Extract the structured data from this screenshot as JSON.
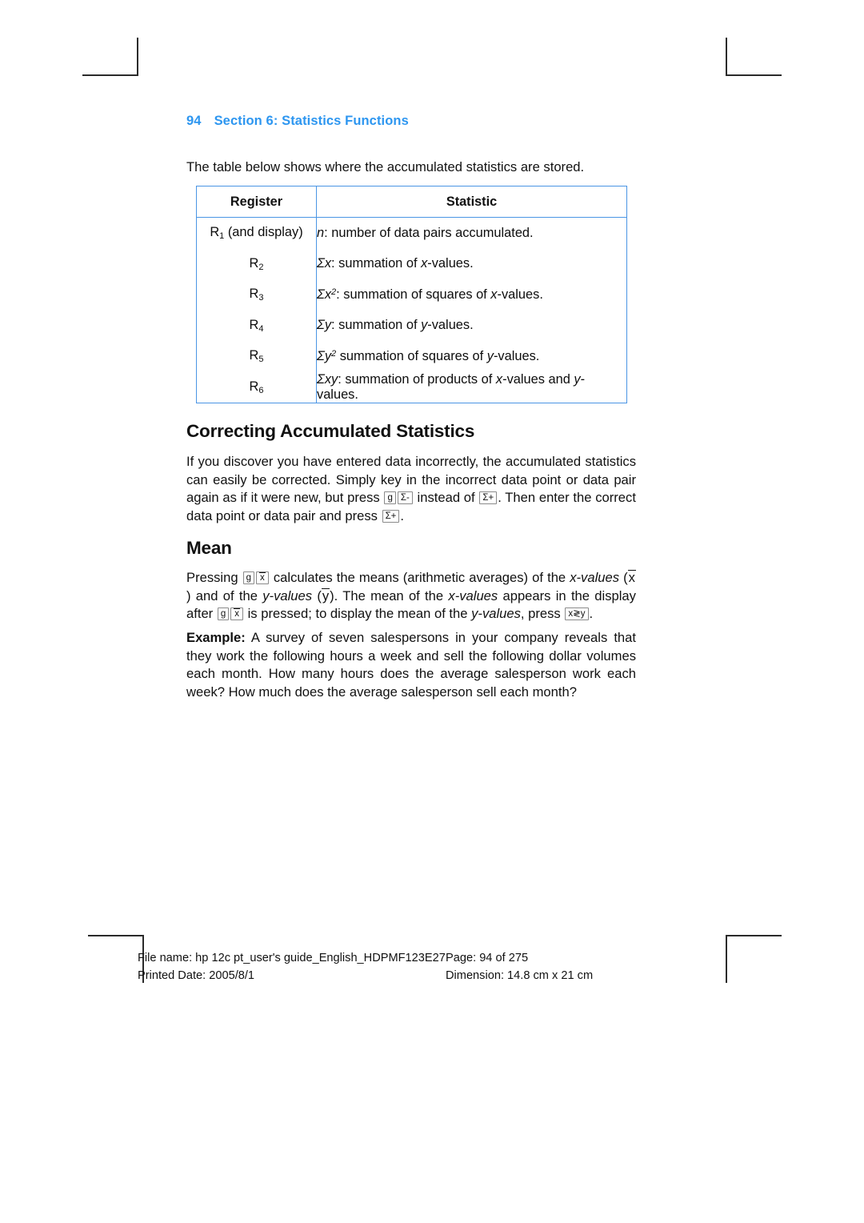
{
  "page": {
    "running_head": {
      "page_number": "94",
      "section_title": "Section 6: Statistics Functions"
    },
    "intro_line": "The table below shows where the accumulated statistics are stored."
  },
  "table": {
    "columns": [
      "Register",
      "Statistic"
    ],
    "rows": [
      {
        "register_base": "R",
        "register_sub": "1",
        "register_suffix": " (and display)",
        "statistic_prefix": "n",
        "statistic_sup": "",
        "statistic_text": ": number of data pairs accumulated."
      },
      {
        "register_base": "R",
        "register_sub": "2",
        "register_suffix": "",
        "statistic_prefix": "Σx",
        "statistic_sup": "",
        "statistic_text": ": summation of x-values."
      },
      {
        "register_base": "R",
        "register_sub": "3",
        "register_suffix": "",
        "statistic_prefix": "Σx",
        "statistic_sup": "2",
        "statistic_text": ": summation of squares of x-values."
      },
      {
        "register_base": "R",
        "register_sub": "4",
        "register_suffix": "",
        "statistic_prefix": "Σy",
        "statistic_sup": "",
        "statistic_text": ": summation of y-values."
      },
      {
        "register_base": "R",
        "register_sub": "5",
        "register_suffix": "",
        "statistic_prefix": "Σy",
        "statistic_sup": "2",
        "statistic_text": " summation of squares of y-values."
      },
      {
        "register_base": "R",
        "register_sub": "6",
        "register_suffix": "",
        "statistic_prefix": "Σxy",
        "statistic_sup": "",
        "statistic_text": ": summation of products of x-values and y-values."
      }
    ]
  },
  "sections": {
    "correcting": {
      "heading": "Correcting Accumulated Statistics",
      "text_1": "If you discover you have entered data incorrectly, the accumulated statistics can easily be corrected. Simply key in the incorrect data point or data pair again as if it were new, but press",
      "key_g": "g",
      "key_sigma_minus": "Σ-",
      "text_2": "instead of",
      "key_sigma_plus_1": "Σ+",
      "text_3": ". Then enter the correct data point or data pair and press",
      "key_sigma_plus_2": "Σ+",
      "text_4": "."
    },
    "mean": {
      "heading": "Mean",
      "text_1": "Pressing",
      "key_g_1": "g",
      "key_xbar_1": "x",
      "text_2": "calculates the means (arithmetic averages) of the",
      "em_1": "x-values",
      "text_3": "(",
      "xbar_inline_1": "x",
      "text_4": ") and of the",
      "em_2": "y-values",
      "text_5": "(",
      "ybar_inline": "y",
      "text_6": "). The mean of the",
      "em_3": "x-values",
      "text_7": "appears in the display after",
      "key_g_2": "g",
      "key_xbar_2": "x",
      "text_8": "is pressed; to display the mean of the",
      "em_4": "y-values",
      "text_9": ", press",
      "key_xy": "x≷y",
      "text_10": "."
    },
    "example": {
      "label": "Example:",
      "text": "A survey of seven salespersons in your company reveals that they work the following hours a week and sell the following dollar volumes each month. How many hours does the average salesperson work each week? How much does the average salesperson sell each month?"
    }
  },
  "footer": {
    "file_name": "File name: hp 12c pt_user's guide_English_HDPMF123E27",
    "page_of": "Page: 94 of 275",
    "printed_date": "Printed Date: 2005/8/1",
    "dimension": "Dimension: 14.8 cm x 21 cm"
  },
  "colors": {
    "accent_blue": "#2d96f0",
    "table_border": "#4a95e4",
    "text": "#111111"
  }
}
